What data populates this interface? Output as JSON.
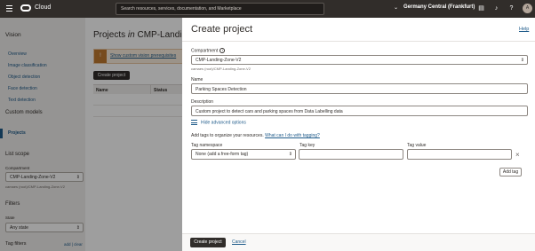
{
  "topbar": {
    "brand": "Cloud",
    "search_placeholder": "Search resources, services, documentation, and Marketplace",
    "region": "Germany Central (Frankfurt)",
    "avatar_initial": "A"
  },
  "sidebar": {
    "title": "Vision",
    "items": [
      {
        "label": "Overview"
      },
      {
        "label": "Image classification"
      },
      {
        "label": "Object detection"
      },
      {
        "label": "Face detection"
      },
      {
        "label": "Text detection"
      }
    ],
    "custom_models_heading": "Custom models",
    "projects_label": "Projects",
    "list_scope_heading": "List scope",
    "compartment_label": "Compartment",
    "compartment_value": "CMP-Landing-Zone-V2",
    "compartment_path": "camaes (root)/CMP-Landing-Zone-V2",
    "filters_heading": "Filters",
    "state_label": "State",
    "state_value": "Any state",
    "tag_filters_label": "Tag filters",
    "add_clear_label": "add | clear"
  },
  "background": {
    "title_prefix": "Projects",
    "title_in": "in",
    "title_compartment": "CMP-Landi",
    "banner_link": "Show custom vision prerequisites",
    "create_button": "Create project",
    "columns": [
      "Name",
      "Status"
    ]
  },
  "drawer": {
    "title": "Create project",
    "help": "Help",
    "compartment_label": "Compartment",
    "compartment_value": "CMP-Landing-Zone-V2",
    "compartment_path": "camaes (root)/CMP-Landing-Zone-V2",
    "name_label": "Name",
    "name_value": "Parking Spaces Detection",
    "description_label": "Description",
    "description_value": "Custom project to detect cars and parking spaces from Data Labelling data",
    "advanced_options": "Hide advanced options",
    "tags_text": "Add tags to organize your resources.",
    "tags_link": "What can I do with tagging?",
    "tag_namespace_label": "Tag namespace",
    "tag_namespace_value": "None (add a free-form tag)",
    "tag_key_label": "Tag key",
    "tag_value_label": "Tag value",
    "add_tag": "Add tag",
    "create_button": "Create project",
    "cancel": "Cancel"
  },
  "colors": {
    "topbar": "#312d2a",
    "link": "#1f5b8a",
    "primary_button": "#312d2a",
    "banner_icon": "#c07a2f"
  }
}
